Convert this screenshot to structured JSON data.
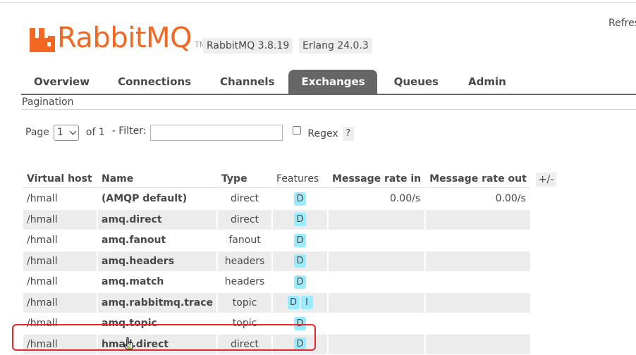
{
  "header": {
    "logo_text": "RabbitMQ",
    "logo_tm": "TM",
    "version_badge": "RabbitMQ 3.8.19",
    "erlang_badge": "Erlang 24.0.3",
    "refresh_text": "Refres",
    "brand_color": "#f26822"
  },
  "tabs": [
    {
      "label": "Overview",
      "active": false
    },
    {
      "label": "Connections",
      "active": false
    },
    {
      "label": "Channels",
      "active": false
    },
    {
      "label": "Exchanges",
      "active": true
    },
    {
      "label": "Queues",
      "active": false
    },
    {
      "label": "Admin",
      "active": false
    }
  ],
  "pagination": {
    "section_title": "Pagination",
    "page_label": "Page",
    "page_value": "1",
    "of_label": "of 1",
    "filter_label": "- Filter:",
    "filter_value": "",
    "regex_label": "Regex",
    "regex_checked": false,
    "help_label": "?"
  },
  "table": {
    "columns": [
      "Virtual host",
      "Name",
      "Type",
      "Features",
      "Message rate in",
      "Message rate out"
    ],
    "toggle_label": "+/-",
    "rows": [
      {
        "vhost": "/hmall",
        "name": "(AMQP default)",
        "type": "direct",
        "features": [
          "D"
        ],
        "rate_in": "0.00/s",
        "rate_out": "0.00/s"
      },
      {
        "vhost": "/hmall",
        "name": "amq.direct",
        "type": "direct",
        "features": [
          "D"
        ],
        "rate_in": "",
        "rate_out": ""
      },
      {
        "vhost": "/hmall",
        "name": "amq.fanout",
        "type": "fanout",
        "features": [
          "D"
        ],
        "rate_in": "",
        "rate_out": ""
      },
      {
        "vhost": "/hmall",
        "name": "amq.headers",
        "type": "headers",
        "features": [
          "D"
        ],
        "rate_in": "",
        "rate_out": ""
      },
      {
        "vhost": "/hmall",
        "name": "amq.match",
        "type": "headers",
        "features": [
          "D"
        ],
        "rate_in": "",
        "rate_out": ""
      },
      {
        "vhost": "/hmall",
        "name": "amq.rabbitmq.trace",
        "type": "topic",
        "features": [
          "D",
          "I"
        ],
        "rate_in": "",
        "rate_out": ""
      },
      {
        "vhost": "/hmall",
        "name": "amq.topic",
        "type": "topic",
        "features": [
          "D"
        ],
        "rate_in": "",
        "rate_out": ""
      },
      {
        "vhost": "/hmall",
        "name": "hmall.direct",
        "type": "direct",
        "features": [
          "D"
        ],
        "rate_in": "",
        "rate_out": "",
        "hovered": true
      }
    ]
  },
  "highlight_color": "#e8262e"
}
